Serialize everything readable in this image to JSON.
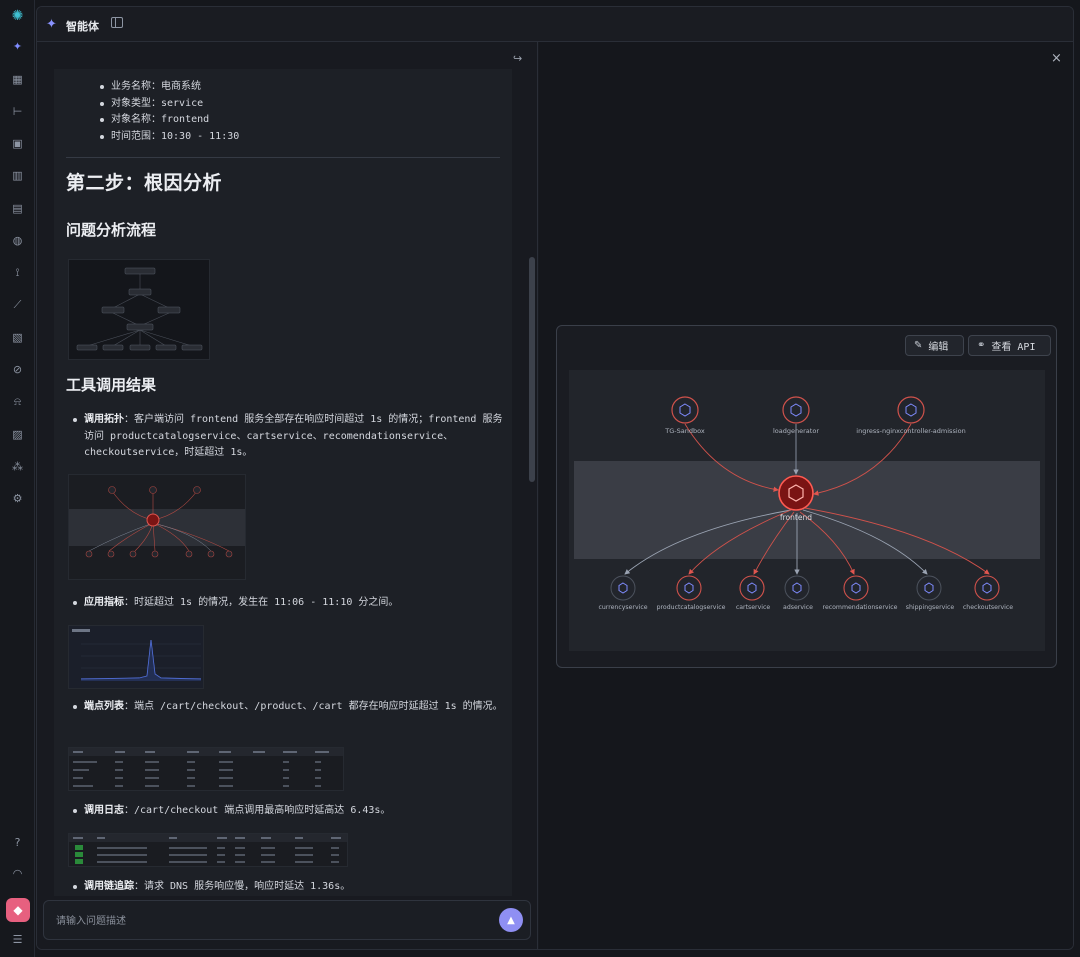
{
  "window": {
    "title": "智能体"
  },
  "rail": {
    "icons": [
      "app-logo-icon",
      "agent-icon",
      "grid-icon",
      "tree-icon",
      "cpu-icon",
      "bar-chart-icon",
      "table-icon",
      "globe-icon",
      "signal-icon",
      "line-chart-icon",
      "doc-icon",
      "block-icon",
      "alert-icon",
      "book-icon",
      "cluster-icon",
      "gear-icon",
      "help-icon",
      "support-icon",
      "settings-icon"
    ]
  },
  "chat": {
    "context_bullets": [
      "业务名称：电商系统",
      "对象类型：service",
      "对象名称：frontend",
      "时间范围：10:30 - 11:30"
    ],
    "step_heading": "第二步：根因分析",
    "flow_heading": "问题分析流程",
    "results_heading": "工具调用结果",
    "results": [
      {
        "label": "调用拓扑",
        "text": "：客户端访问 frontend 服务全部存在响应时间超过 1s 的情况；frontend 服务访问 productcatalogservice、cartservice、recomendationservice、checkoutservice，时延超过 1s。"
      },
      {
        "label": "应用指标",
        "text": "：时延超过 1s 的情况，发生在 11:06 - 11:10 分之间。"
      },
      {
        "label": "端点列表",
        "text": "：端点 /cart/checkout、/product、/cart 都存在响应时延超过 1s 的情况。"
      },
      {
        "label": "调用日志",
        "text": "：/cart/checkout 端点调用最高响应时延高达 6.43s。"
      },
      {
        "label": "调用链追踪",
        "text": "：请求 DNS 服务响应慢，响应时延达 1.36s。"
      }
    ],
    "input_placeholder": "请输入问题描述"
  },
  "right_panel": {
    "edit_label": "编辑",
    "api_label": "查看 API",
    "topology": {
      "center": "frontend",
      "upstream": [
        "TG-Sandbox",
        "loadgenerator",
        "ingress-nginxcontroller-admission"
      ],
      "downstream": [
        "currencyservice",
        "productcatalogservice",
        "cartservice",
        "adservice",
        "recommendationservice",
        "shippingservice",
        "checkoutservice"
      ],
      "colors": {
        "error": "#e0564f",
        "normal": "#8c96a8",
        "center_fill": "#7a1414"
      }
    }
  }
}
